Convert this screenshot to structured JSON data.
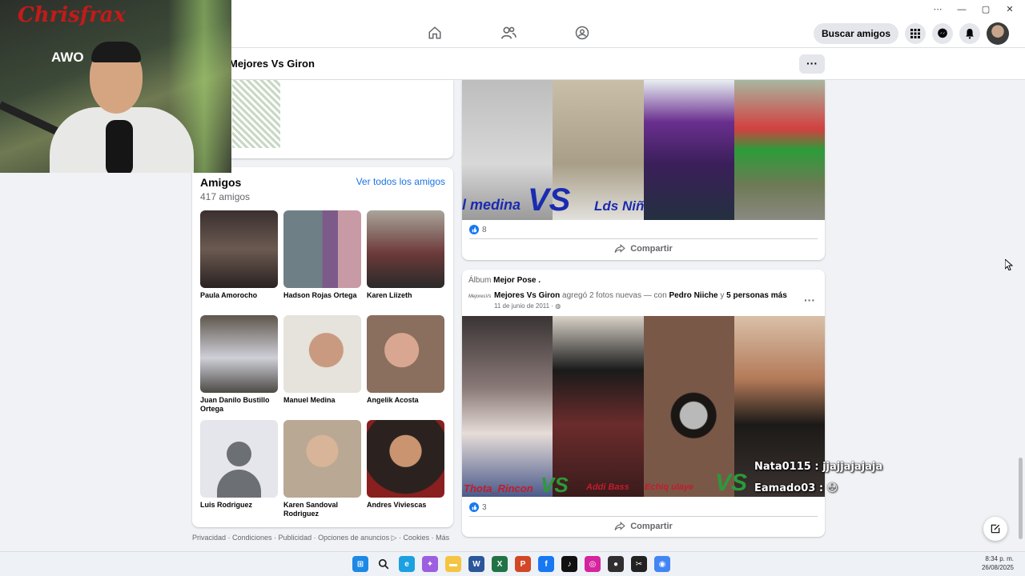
{
  "topnav": {
    "search_friends_label": "Buscar amigos",
    "icons": [
      "home-icon",
      "friends-icon",
      "groups-icon",
      "apps-grid-icon",
      "messenger-icon",
      "notifications-icon"
    ]
  },
  "window_controls": [
    "⋯",
    "—",
    "▢",
    "✕"
  ],
  "page": {
    "name": "Mejores Vs Giron",
    "more_label": "···"
  },
  "webcam": {
    "brand_text": "Chrisfrax",
    "brand_sub": "AWO"
  },
  "friends": {
    "title": "Amigos",
    "count": "417 amigos",
    "see_all_label": "Ver todos los amigos",
    "items": [
      {
        "name": "Paula Amorocho",
        "color": "#5a4a45"
      },
      {
        "name": "Hadson Rojas Ortega",
        "color": "#7a6a80"
      },
      {
        "name": "Karen Liizeth",
        "color": "#8a8070"
      },
      {
        "name": "Juan Danilo Bustillo Ortega",
        "color": "#6a6258"
      },
      {
        "name": "Manuel Medina",
        "color": "#b0a9a0"
      },
      {
        "name": "Angelik Acosta",
        "color": "#b5988a"
      },
      {
        "name": "Luis Rodriguez",
        "color": "#e4e6eb"
      },
      {
        "name": "Karen Sandoval Rodriguez",
        "color": "#c9b8a8"
      },
      {
        "name": "Andres Viviescas",
        "color": "#3b3430"
      }
    ]
  },
  "footer": {
    "text": "Privacidad · Condiciones · Publicidad · Opciones de anuncios ▷ · Cookies · Más"
  },
  "post1": {
    "vs_left": "l medina",
    "vs_mid": "VS",
    "vs_right": "Lds Niñ",
    "likes": "8",
    "share_label": "Compartir"
  },
  "post2": {
    "album_prefix": "Álbum",
    "album_name": "Mejor Pose .",
    "page_name": "Mejores Vs Giron",
    "action_text": "agregó 2 fotos nuevas — con",
    "tagged": "Pedro Niiche",
    "and_text": "y",
    "others": "5 personas más",
    "date": "11 de junio de 2011 ·",
    "avatar_text": "MejoresVs",
    "caption_left": "Thota_Rincon",
    "caption_mid": "VS",
    "caption_right": "Addi Bass",
    "caption_right2": "Echiq ulaye",
    "likes": "3",
    "share_label": "Compartir"
  },
  "chat": {
    "line1": "Nata0115 : jjajjajajaja",
    "line2": "Eamado03 : 😳"
  },
  "taskbar": {
    "apps": [
      {
        "name": "windows-start-icon",
        "color": "#1e88e5",
        "glyph": "⊞"
      },
      {
        "name": "search-icon",
        "color": "#eef1f6",
        "glyph": ""
      },
      {
        "name": "edge-icon",
        "color": "#1ba1e2",
        "glyph": "e"
      },
      {
        "name": "copilot-icon",
        "color": "#9c5fe0",
        "glyph": "✦"
      },
      {
        "name": "file-explorer-icon",
        "color": "#f4c542",
        "glyph": "▬"
      },
      {
        "name": "word-icon",
        "color": "#2b579a",
        "glyph": "W"
      },
      {
        "name": "excel-icon",
        "color": "#217346",
        "glyph": "X"
      },
      {
        "name": "powerpoint-icon",
        "color": "#d24726",
        "glyph": "P"
      },
      {
        "name": "facebook-icon",
        "color": "#1877f2",
        "glyph": "f"
      },
      {
        "name": "tiktok-icon",
        "color": "#111111",
        "glyph": "♪"
      },
      {
        "name": "instagram-icon",
        "color": "#d6249f",
        "glyph": "◎"
      },
      {
        "name": "obs-icon",
        "color": "#302e31",
        "glyph": "●"
      },
      {
        "name": "capcut-icon",
        "color": "#222222",
        "glyph": "✂"
      },
      {
        "name": "chrome-icon",
        "color": "#4285f4",
        "glyph": "◉"
      }
    ],
    "time": "8:34 p. m.",
    "date": "26/08/2025"
  }
}
